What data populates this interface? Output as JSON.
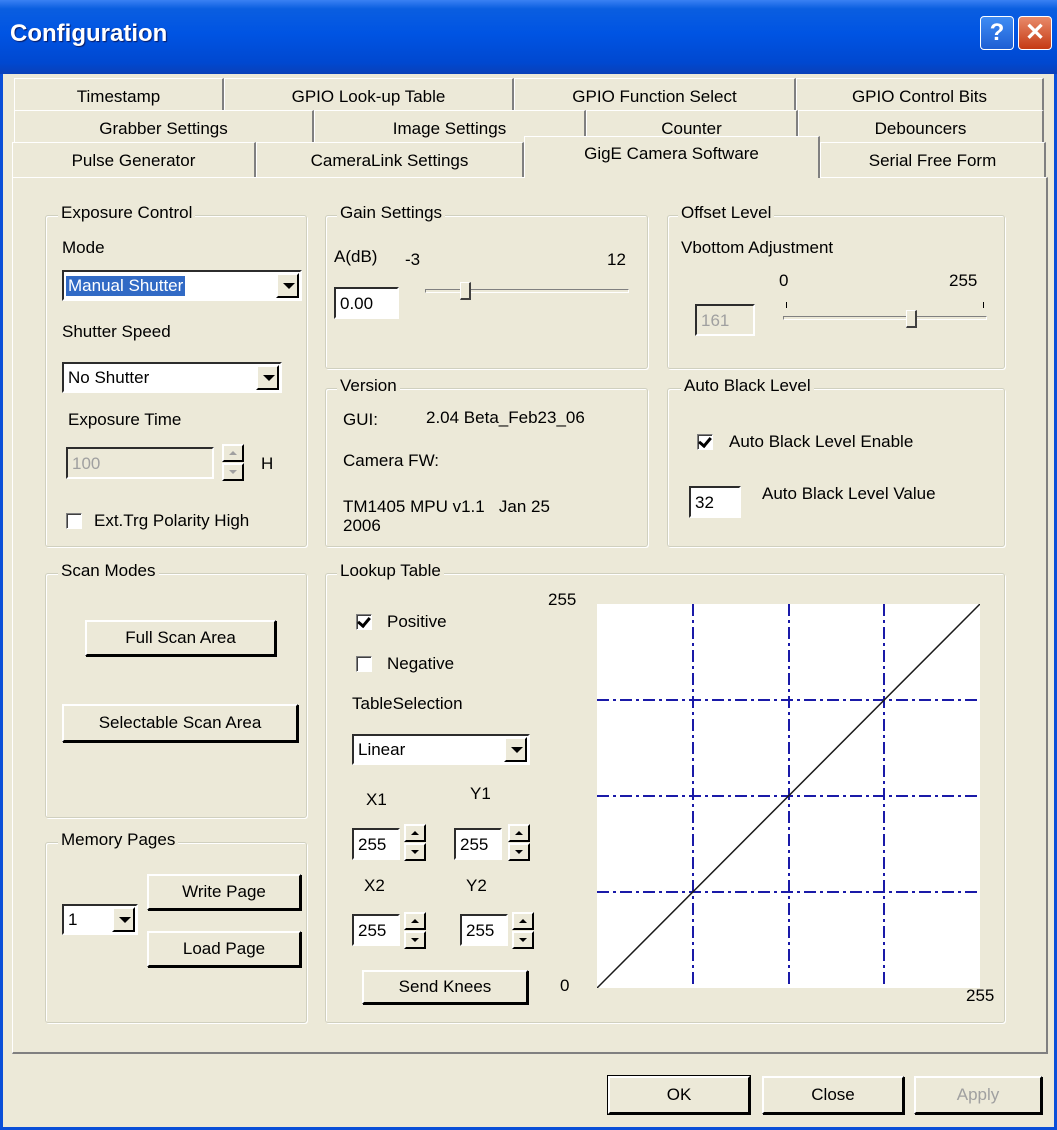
{
  "window": {
    "title": "Configuration",
    "help_glyph": "?",
    "close_glyph": "✕"
  },
  "tabs": {
    "row1": [
      "Timestamp",
      "GPIO Look-up Table",
      "GPIO Function Select",
      "GPIO Control Bits"
    ],
    "row2": [
      "Grabber Settings",
      "Image Settings",
      "Counter",
      "Debouncers"
    ],
    "row3": [
      "Pulse Generator",
      "CameraLink Settings",
      "GigE Camera Software",
      "Serial Free Form"
    ],
    "selected": "GigE Camera Software"
  },
  "exposure": {
    "legend": "Exposure Control",
    "mode_label": "Mode",
    "mode_value": "Manual Shutter",
    "shutter_speed_label": "Shutter Speed",
    "shutter_speed_value": "No Shutter",
    "exposure_time_label": "Exposure Time",
    "exposure_time_value": "100",
    "exposure_unit": "H",
    "ext_trg_label": "Ext.Trg Polarity High",
    "ext_trg_checked": false
  },
  "gain": {
    "legend": "Gain Settings",
    "label": "A(dB)",
    "min": "-3",
    "max": "12",
    "value": "0.00",
    "slider_fraction": 0.2
  },
  "offset": {
    "legend": "Offset Level",
    "label": "Vbottom Adjustment",
    "min": "0",
    "max": "255",
    "value": "161",
    "slider_fraction": 0.63
  },
  "version": {
    "legend": "Version",
    "gui_label": "GUI:",
    "gui_value": "2.04 Beta_Feb23_06",
    "fw_label": "Camera FW:",
    "fw_value_line1": "TM1405 MPU v1.1   Jan 25",
    "fw_value_line2": "2006"
  },
  "auto_black": {
    "legend": "Auto Black Level",
    "enable_label": "Auto Black Level Enable",
    "enable_checked": true,
    "value_label": "Auto Black Level Value",
    "value": "32"
  },
  "scan": {
    "legend": "Scan Modes",
    "full_button": "Full Scan Area",
    "selectable_button": "Selectable Scan Area"
  },
  "memory": {
    "legend": "Memory Pages",
    "page_value": "1",
    "write_button": "Write Page",
    "load_button": "Load Page"
  },
  "lookup": {
    "legend": "Lookup Table",
    "positive_label": "Positive",
    "positive_checked": true,
    "negative_label": "Negative",
    "negative_checked": false,
    "table_selection_label": "TableSelection",
    "table_selection_value": "Linear",
    "x1_label": "X1",
    "x1_value": "255",
    "y1_label": "Y1",
    "y1_value": "255",
    "x2_label": "X2",
    "x2_value": "255",
    "y2_label": "Y2",
    "y2_value": "255",
    "send_button": "Send Knees",
    "graph_top_label": "255",
    "graph_origin_label": "0",
    "graph_right_label": "255"
  },
  "dialog_buttons": {
    "ok": "OK",
    "close": "Close",
    "apply": "Apply"
  },
  "colors": {
    "title_bar": "#0054e3",
    "grid_lines": "#1a1aa8",
    "face": "#ece9d8"
  }
}
